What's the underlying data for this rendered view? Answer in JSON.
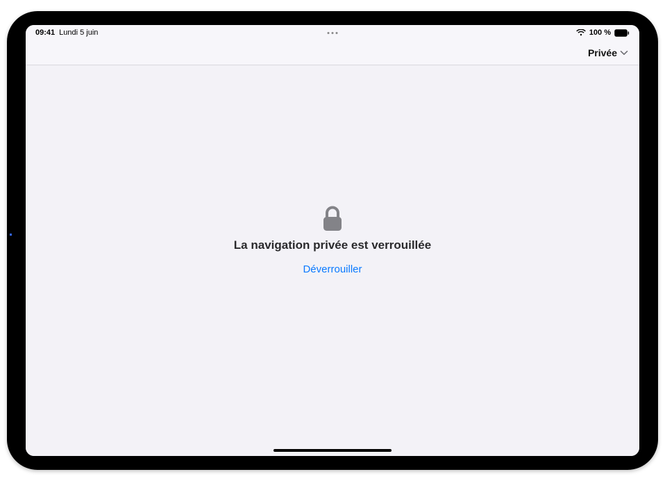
{
  "statusbar": {
    "time": "09:41",
    "date": "Lundi 5 juin",
    "battery_text": "100 %"
  },
  "toolbar": {
    "tabgroup_label": "Privée"
  },
  "main": {
    "locked_title": "La navigation privée est verrouillée",
    "unlock_label": "Déverrouiller"
  },
  "icons": {
    "lock": "lock-icon",
    "chevron": "chevron-down-icon",
    "wifi": "wifi-icon",
    "battery": "battery-icon",
    "multitask": "multitask-dots-icon"
  },
  "colors": {
    "link": "#0a7aff",
    "screen_bg": "#f3f2f7",
    "text": "#2a2a2c",
    "icon_gray": "#838388"
  }
}
